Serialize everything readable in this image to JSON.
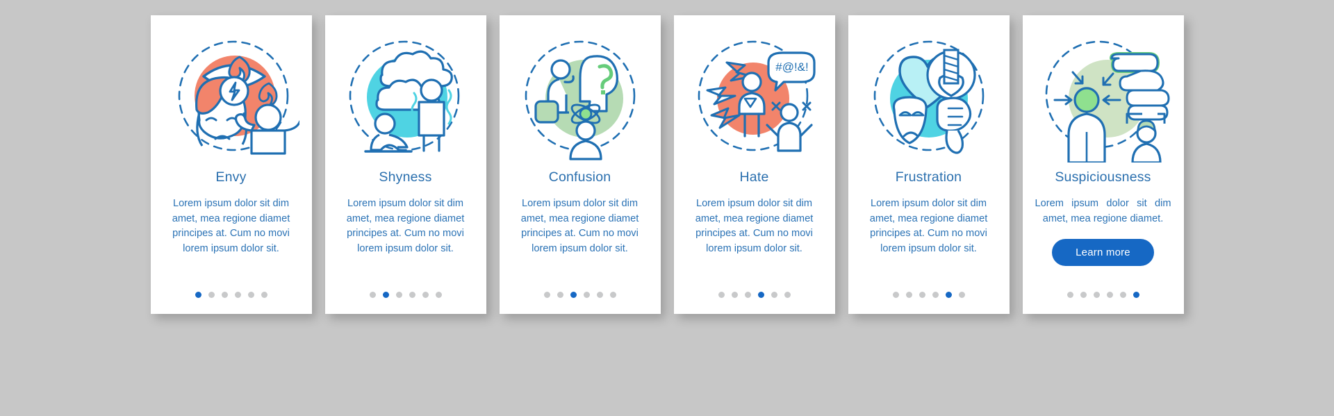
{
  "page": {
    "background_color": "#c7c7c7",
    "card_background": "#ffffff",
    "title_color": "#2a6fae",
    "body_color": "#2a72b5",
    "accent_color": "#1668c4",
    "dot_inactive_color": "#c8c9ca",
    "total_steps": 6
  },
  "cards": [
    {
      "id": "envy",
      "icon_name": "envy-concept-icon",
      "title": "Envy",
      "body": "Lorem ipsum dolor sit dim amet, mea regione diamet principes at. Cum no movi lorem ipsum dolor sit.",
      "active_step": 1,
      "blob_color": "#f2846b",
      "has_cta": false,
      "cta_label": ""
    },
    {
      "id": "shyness",
      "icon_name": "shyness-concept-icon",
      "title": "Shyness",
      "body": "Lorem ipsum dolor sit dim amet, mea regione diamet principes at. Cum no movi lorem ipsum dolor sit.",
      "active_step": 2,
      "blob_color": "#4fd3e3",
      "has_cta": false,
      "cta_label": ""
    },
    {
      "id": "confusion",
      "icon_name": "confusion-concept-icon",
      "title": "Confusion",
      "body": "Lorem ipsum dolor sit dim amet, mea regione diamet principes at. Cum no movi lorem ipsum dolor sit.",
      "active_step": 3,
      "blob_color": "#b6dbb4",
      "has_cta": false,
      "cta_label": ""
    },
    {
      "id": "hate",
      "icon_name": "hate-concept-icon",
      "title": "Hate",
      "body": "Lorem ipsum dolor sit dim amet, mea regione diamet principes at. Cum no movi lorem ipsum dolor sit.",
      "active_step": 4,
      "blob_color": "#f2846b",
      "speech_text": "#@!&!",
      "has_cta": false,
      "cta_label": ""
    },
    {
      "id": "frustration",
      "icon_name": "frustration-concept-icon",
      "title": "Frustration",
      "body": "Lorem ipsum dolor sit dim amet, mea regione diamet principes at. Cum no movi lorem ipsum dolor sit.",
      "active_step": 5,
      "blob_color": "#4fd3e3",
      "has_cta": false,
      "cta_label": ""
    },
    {
      "id": "suspiciousness",
      "icon_name": "suspiciousness-concept-icon",
      "title": "Suspiciousness",
      "body": "Lorem ipsum dolor sit dim amet, mea regione diamet.",
      "active_step": 6,
      "blob_color": "#cfe3c4",
      "has_cta": true,
      "cta_label": "Learn more"
    }
  ]
}
